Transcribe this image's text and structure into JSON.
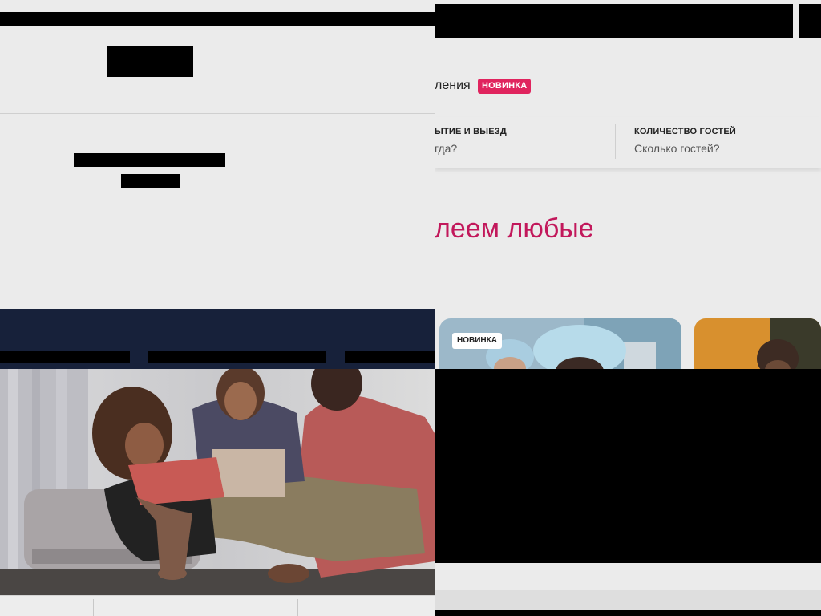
{
  "header": {
    "nav_partial_label": "ления",
    "new_badge": "НОВИНКА"
  },
  "search": {
    "dates_label": "ЫТИЕ И ВЫЕЗД",
    "dates_value": "гда?",
    "guests_label": "КОЛИЧЕСТВО ГОСТЕЙ",
    "guests_value": "Сколько гостей?"
  },
  "main": {
    "headline_partial": "леем любые"
  },
  "cards": [
    {
      "badge": "НОВИНКА"
    }
  ],
  "colors": {
    "accent": "#c2185b",
    "badge_red": "#e0245e",
    "navy": "#17213a",
    "background": "#ebebeb"
  }
}
